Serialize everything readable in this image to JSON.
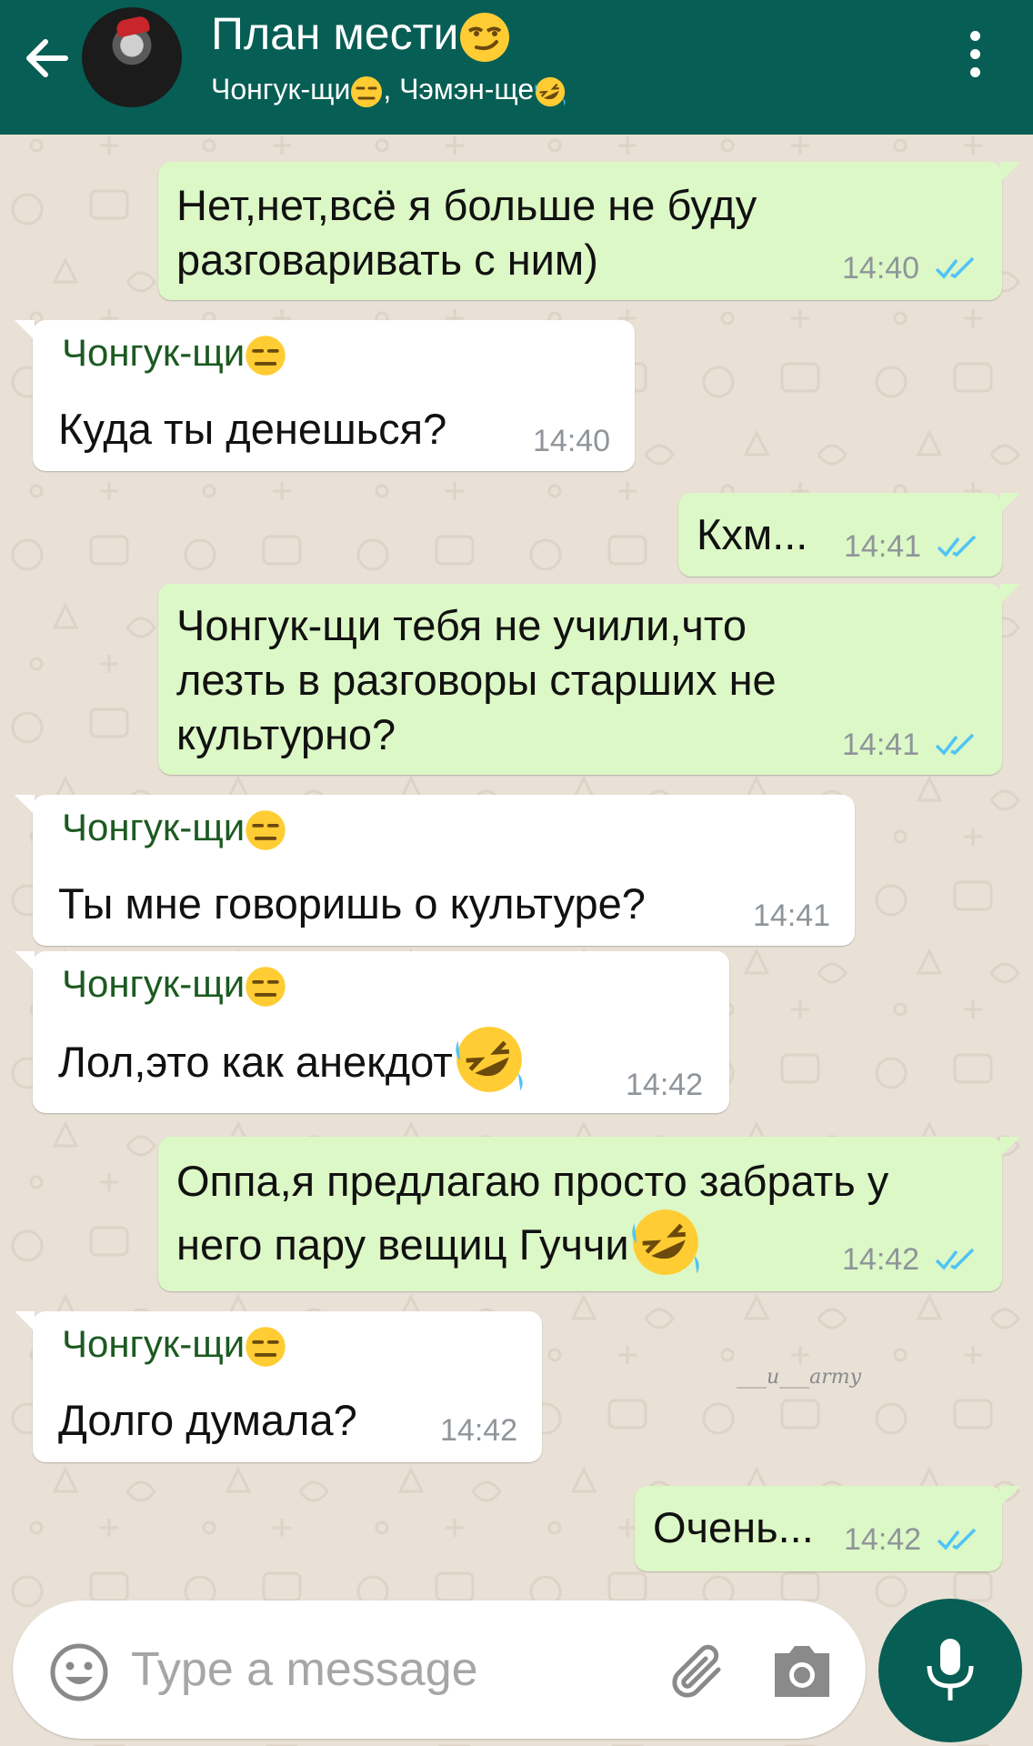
{
  "header": {
    "title": "План мести",
    "title_emoji": "smirk-emoji",
    "subtitle_parts": [
      {
        "name": "Чонгук-щи",
        "emoji": "expressionless-emoji"
      },
      {
        "sep": ", "
      },
      {
        "name": "Чэмэн-ще",
        "emoji": "rofl-emoji"
      }
    ],
    "subtitle_sep": ", ",
    "icons": {
      "back": "arrow-left-icon",
      "avatar": "group-avatar",
      "menu": "more-vertical-icon"
    }
  },
  "messages": [
    {
      "dir": "out",
      "lines": [
        "Нет,нет,всё я больше не буду",
        "разговаривать с ним)"
      ],
      "time": "14:40",
      "read": true
    },
    {
      "dir": "in",
      "sender": "Чонгук-щи",
      "lines": [
        "Куда ты денешься?"
      ],
      "time": "14:40"
    },
    {
      "dir": "out",
      "lines": [
        "Кхм..."
      ],
      "time": "14:41",
      "read": true
    },
    {
      "dir": "out",
      "lines": [
        "Чонгук-щи тебя не учили,что",
        "лезть в разговоры старших не",
        "культурно?"
      ],
      "time": "14:41",
      "read": true
    },
    {
      "dir": "in",
      "sender": "Чонгук-щи",
      "lines": [
        "Ты мне говоришь о культуре?"
      ],
      "time": "14:41"
    },
    {
      "dir": "in",
      "sender": "Чонгук-щи",
      "lines": [
        "Лол,это как анекдот"
      ],
      "emoji": "rofl-emoji",
      "time": "14:42"
    },
    {
      "dir": "out",
      "lines": [
        "Оппа,я предлагаю просто забрать у",
        "него пару вещиц Гуччи"
      ],
      "emoji": "rofl-emoji",
      "time": "14:42",
      "read": true
    },
    {
      "dir": "in",
      "sender": "Чонгук-щи",
      "lines": [
        "Долго думала?"
      ],
      "time": "14:42"
    },
    {
      "dir": "out",
      "lines": [
        "Очень..."
      ],
      "time": "14:42",
      "read": true
    }
  ],
  "sender_emoji": "expressionless-emoji",
  "watermark": "___u___army",
  "composer": {
    "placeholder": "Type a message",
    "icons": {
      "emoji": "smiley-icon",
      "attach": "paperclip-icon",
      "camera": "camera-icon",
      "mic": "mic-icon"
    }
  },
  "colors": {
    "header": "#075e54",
    "outgoing_bubble": "#dcf8c6",
    "incoming_bubble": "#ffffff",
    "sender_name": "#1c5a21",
    "read_ticks": "#4fc3f7",
    "chat_background": "#e9e1d6"
  }
}
